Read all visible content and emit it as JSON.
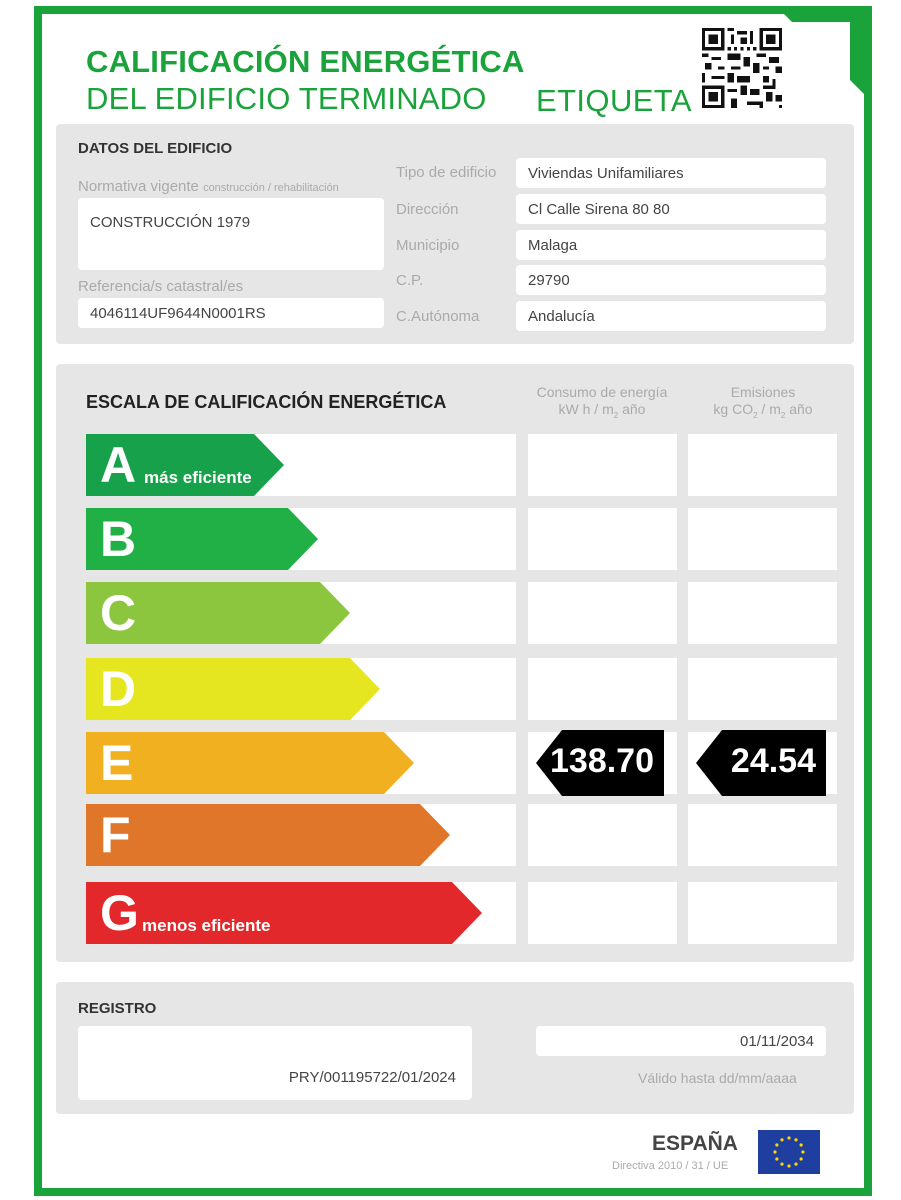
{
  "header": {
    "title_line1": "CALIFICACIÓN ENERGÉTICA",
    "title_line2": "DEL EDIFICIO TERMINADO",
    "title_label": "ETIQUETA",
    "qr_icon": "qr-code-icon"
  },
  "building": {
    "heading": "DATOS DEL EDIFICIO",
    "normativa_label": "Normativa vigente",
    "normativa_sublabel": "construcción / rehabilitación",
    "normativa_value": "CONSTRUCCIÓN  1979",
    "referencia_label": "Referencia/s catastral/es",
    "referencia_value": "4046114UF9644N0001RS",
    "fields": [
      {
        "label": "Tipo de edificio",
        "value": "Viviendas Unifamiliares"
      },
      {
        "label": "Dirección",
        "value": "Cl Calle Sirena 80 80"
      },
      {
        "label": "Municipio",
        "value": "Malaga"
      },
      {
        "label": "C.P.",
        "value": "29790"
      },
      {
        "label": "C.Autónoma",
        "value": "Andalucía"
      }
    ]
  },
  "scale": {
    "heading": "ESCALA DE CALIFICACIÓN ENERGÉTICA",
    "consumo_head_line1": "Consumo de energía",
    "consumo_head_line2a": "kW h / m",
    "consumo_head_sub": "2",
    "consumo_head_line2b": " año",
    "emisiones_head_line1": "Emisiones",
    "emisiones_head_line2a": "kg CO",
    "emisiones_head_sub1": "2",
    "emisiones_head_line2b": " / m",
    "emisiones_head_sub2": "2",
    "emisiones_head_line2c": " año",
    "classes": [
      {
        "letter": "A",
        "label": "más eficiente",
        "color": "#17a14a"
      },
      {
        "letter": "B",
        "label": "",
        "color": "#20b046"
      },
      {
        "letter": "C",
        "label": "",
        "color": "#8cc63f"
      },
      {
        "letter": "D",
        "label": "",
        "color": "#e6e620"
      },
      {
        "letter": "E",
        "label": "",
        "color": "#f0b020"
      },
      {
        "letter": "F",
        "label": "",
        "color": "#e0762a"
      },
      {
        "letter": "G",
        "label": "menos eficiente",
        "color": "#e2282a"
      }
    ],
    "rating_class": "E",
    "consumo_value": "138.70",
    "emisiones_value": "24.54"
  },
  "registro": {
    "heading": "REGISTRO",
    "number": "PRY/001195722/01/2024",
    "valid_date": "01/11/2034",
    "valid_label": "Válido hasta dd/mm/aaaa"
  },
  "footer": {
    "country": "ESPAÑA",
    "directive": "Directiva 2010 / 31 / UE",
    "flag_icon": "eu-flag-icon"
  }
}
